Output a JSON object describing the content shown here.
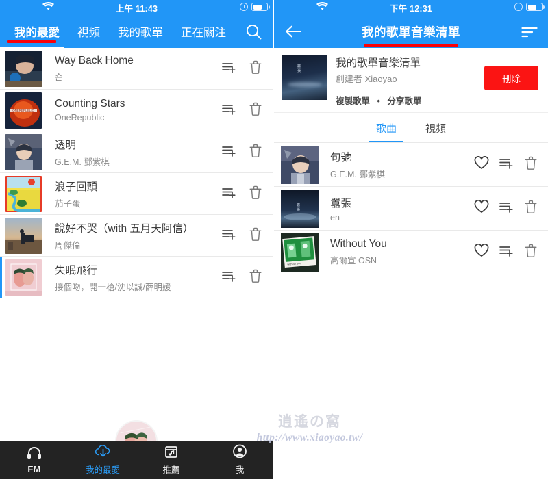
{
  "left": {
    "status": {
      "time": "上午 11:43",
      "wifi_icon": "wifi-icon",
      "alarm_icon": "alarm-icon",
      "battery_icon": "battery-icon"
    },
    "tabs": [
      {
        "label": "我的最愛",
        "active": true
      },
      {
        "label": "視頻",
        "active": false
      },
      {
        "label": "我的歌單",
        "active": false
      },
      {
        "label": "正在關注",
        "active": false
      }
    ],
    "search_icon": "search-icon",
    "songs": [
      {
        "title": "Way Back Home",
        "artist": "숀",
        "add_icon": "playlist-add-icon",
        "delete_icon": "trash-icon",
        "marked": false
      },
      {
        "title": "Counting Stars",
        "artist": "OneRepublic",
        "add_icon": "playlist-add-icon",
        "delete_icon": "trash-icon",
        "marked": false
      },
      {
        "title": "透明",
        "artist": "G.E.M. 鄧紫棋",
        "add_icon": "playlist-add-icon",
        "delete_icon": "trash-icon",
        "marked": false
      },
      {
        "title": "浪子回頭",
        "artist": "茄子蛋",
        "add_icon": "playlist-add-icon",
        "delete_icon": "trash-icon",
        "marked": false
      },
      {
        "title": "說好不哭（with 五月天阿信）",
        "artist": "周傑倫",
        "add_icon": "playlist-add-icon",
        "delete_icon": "trash-icon",
        "marked": false
      },
      {
        "title": "失眠飛行",
        "artist": "接個吻，開一槍/沈以誠/薛明媛",
        "add_icon": "playlist-add-icon",
        "delete_icon": "trash-icon",
        "marked": true
      }
    ],
    "bottom_nav": [
      {
        "label": "FM",
        "icon": "headphones-icon",
        "active": false,
        "highlighted": false
      },
      {
        "label": "我的最愛",
        "icon": "cloud-download-icon",
        "active": true,
        "highlighted": true
      },
      {
        "label": "推薦",
        "icon": "music-folder-icon",
        "active": false,
        "highlighted": false
      },
      {
        "label": "我",
        "icon": "account-icon",
        "active": false,
        "highlighted": false
      }
    ]
  },
  "right": {
    "status": {
      "time": "下午 12:31",
      "wifi_icon": "wifi-icon",
      "alarm_icon": "alarm-icon",
      "battery_icon": "battery-icon"
    },
    "nav": {
      "back_icon": "back-arrow-icon",
      "title": "我的歌單音樂清單",
      "sort_icon": "sort-icon"
    },
    "playlist": {
      "name": "我的歌單音樂清單",
      "creator": "創建者 Xiaoyao",
      "copy_label": "複製歌單",
      "separator": "•",
      "share_label": "分享歌單",
      "delete_label": "刪除",
      "cover_icon": "album-cover"
    },
    "sub_tabs": [
      {
        "label": "歌曲",
        "active": true
      },
      {
        "label": "視頻",
        "active": false
      }
    ],
    "songs": [
      {
        "title": "句號",
        "artist": "G.E.M. 鄧紫棋",
        "fav_icon": "heart-icon",
        "add_icon": "playlist-add-icon",
        "delete_icon": "trash-icon"
      },
      {
        "title": "囂張",
        "artist": "en",
        "fav_icon": "heart-icon",
        "add_icon": "playlist-add-icon",
        "delete_icon": "trash-icon"
      },
      {
        "title": "Without You",
        "artist": "高爾宣 OSN",
        "fav_icon": "heart-icon",
        "add_icon": "playlist-add-icon",
        "delete_icon": "trash-icon"
      }
    ]
  },
  "watermark": {
    "cn": "逍遙の窩",
    "url": "http://www.xiaoyao.tw/"
  },
  "colors": {
    "brand_blue": "#2196f7",
    "accent_red": "#fb0007",
    "delete_red": "#fb1413",
    "nav_dark": "#232323",
    "text_primary": "#3c3c3c",
    "text_secondary": "#8a8a8a"
  }
}
